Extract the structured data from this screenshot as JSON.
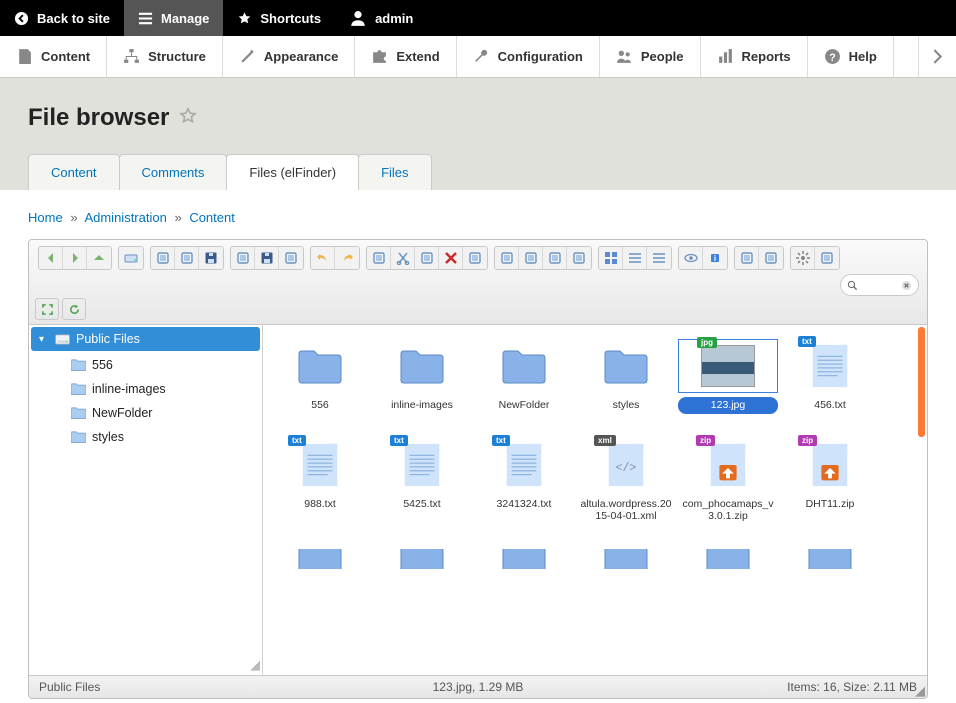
{
  "topbar": {
    "back": "Back to site",
    "manage": "Manage",
    "shortcuts": "Shortcuts",
    "user": "admin"
  },
  "adminmenu": [
    "Content",
    "Structure",
    "Appearance",
    "Extend",
    "Configuration",
    "People",
    "Reports",
    "Help"
  ],
  "page_title": "File browser",
  "subtabs": [
    {
      "label": "Content",
      "active": false
    },
    {
      "label": "Comments",
      "active": false
    },
    {
      "label": "Files (elFinder)",
      "active": true
    },
    {
      "label": "Files",
      "active": false
    }
  ],
  "breadcrumb": [
    "Home",
    "Administration",
    "Content"
  ],
  "tree": {
    "root": "Public Files",
    "children": [
      "556",
      "inline-images",
      "NewFolder",
      "styles"
    ]
  },
  "files_row1": [
    {
      "name": "556",
      "type": "folder"
    },
    {
      "name": "inline-images",
      "type": "folder"
    },
    {
      "name": "NewFolder",
      "type": "folder"
    },
    {
      "name": "styles",
      "type": "folder"
    },
    {
      "name": "123.jpg",
      "type": "jpg",
      "selected": true
    },
    {
      "name": "456.txt",
      "type": "txt"
    }
  ],
  "files_row2": [
    {
      "name": "988.txt",
      "type": "txt"
    },
    {
      "name": "5425.txt",
      "type": "txt"
    },
    {
      "name": "3241324.txt",
      "type": "txt"
    },
    {
      "name": "altula.wordpress.2015-04-01.xml",
      "type": "xml"
    },
    {
      "name": "com_phocamaps_v3.0.1.zip",
      "type": "zip"
    },
    {
      "name": "DHT11.zip",
      "type": "zip"
    }
  ],
  "statusbar": {
    "path": "Public Files",
    "selection": "123.jpg, 1.29 MB",
    "summary": "Items: 16, Size: 2.11 MB"
  },
  "toolbar_row1": [
    {
      "n": "back",
      "group": 0
    },
    {
      "n": "forward",
      "group": 0
    },
    {
      "n": "up",
      "group": 0
    },
    {
      "n": "netmount",
      "group": 1
    },
    {
      "n": "newfolder",
      "group": 2
    },
    {
      "n": "newfile",
      "group": 2
    },
    {
      "n": "upload",
      "group": 2
    },
    {
      "n": "open",
      "group": 3
    },
    {
      "n": "download",
      "group": 3
    },
    {
      "n": "getfile",
      "group": 3
    },
    {
      "n": "undo",
      "group": 4
    },
    {
      "n": "redo",
      "group": 4
    },
    {
      "n": "copy",
      "group": 5
    },
    {
      "n": "cut",
      "group": 5
    },
    {
      "n": "paste",
      "group": 5
    },
    {
      "n": "rm",
      "group": 5
    },
    {
      "n": "empty",
      "group": 5
    },
    {
      "n": "duplicate",
      "group": 6
    },
    {
      "n": "selectall",
      "group": 6
    },
    {
      "n": "selectnone",
      "group": 6
    },
    {
      "n": "selectinvert",
      "group": 6
    },
    {
      "n": "icons",
      "group": 7
    },
    {
      "n": "list",
      "group": 7
    },
    {
      "n": "sort",
      "group": 7
    },
    {
      "n": "preview",
      "group": 8
    },
    {
      "n": "info",
      "group": 8
    },
    {
      "n": "extract",
      "group": 9
    },
    {
      "n": "archive",
      "group": 9
    },
    {
      "n": "places",
      "group": 10
    },
    {
      "n": "chmod",
      "group": 10
    }
  ],
  "toolbar_row2": [
    {
      "n": "fullscreen"
    },
    {
      "n": "reload"
    }
  ]
}
